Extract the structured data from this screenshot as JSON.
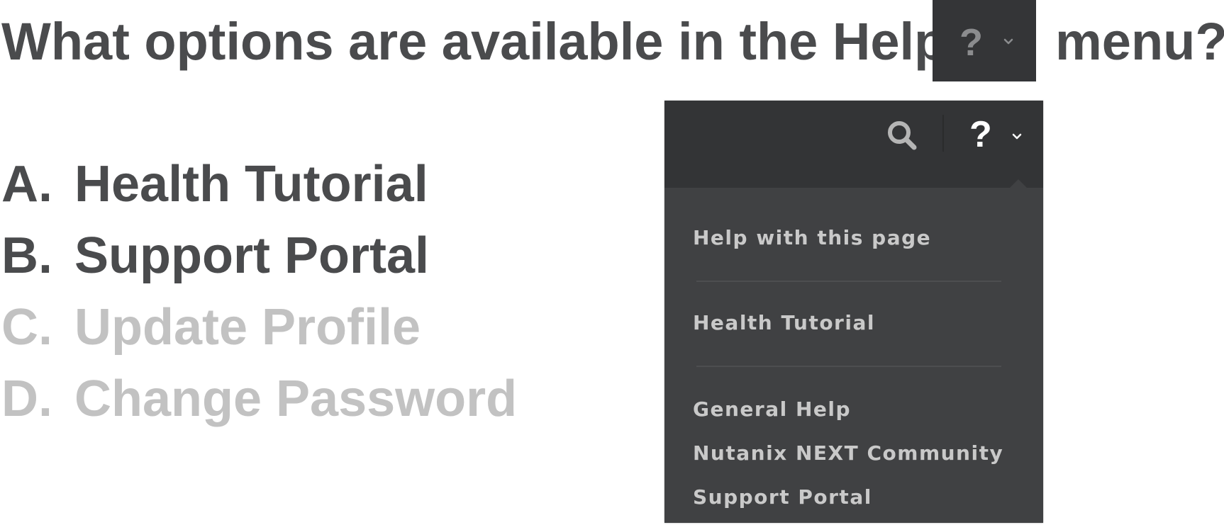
{
  "question": {
    "text_before": "What options are available in the Help",
    "text_after": "menu?",
    "help_icon": "question-mark-icon",
    "help_chevron": "chevron-down-icon",
    "help_glyph": "?"
  },
  "options": [
    {
      "letter": "A.",
      "label": "Health Tutorial",
      "state": "correct"
    },
    {
      "letter": "B.",
      "label": "Support Portal",
      "state": "correct"
    },
    {
      "letter": "C.",
      "label": "Update Profile",
      "state": "incorrect"
    },
    {
      "letter": "D.",
      "label": "Change Password",
      "state": "incorrect"
    }
  ],
  "help_menu": {
    "header": {
      "search_icon": "search-icon",
      "help_icon": "question-mark-icon",
      "help_glyph": "?",
      "chevron_icon": "chevron-down-icon"
    },
    "items": [
      {
        "label": "Help with this page"
      },
      {
        "label": "Health Tutorial"
      },
      {
        "label": "General Help"
      },
      {
        "label": "Nutanix NEXT Community"
      },
      {
        "label": "Support Portal"
      }
    ]
  },
  "colors": {
    "correct_text": "#4a4b4d",
    "incorrect_text": "#c2c2c2",
    "menu_header_bg": "#333436",
    "menu_bg": "#404143",
    "menu_text": "#c9c9c9"
  }
}
